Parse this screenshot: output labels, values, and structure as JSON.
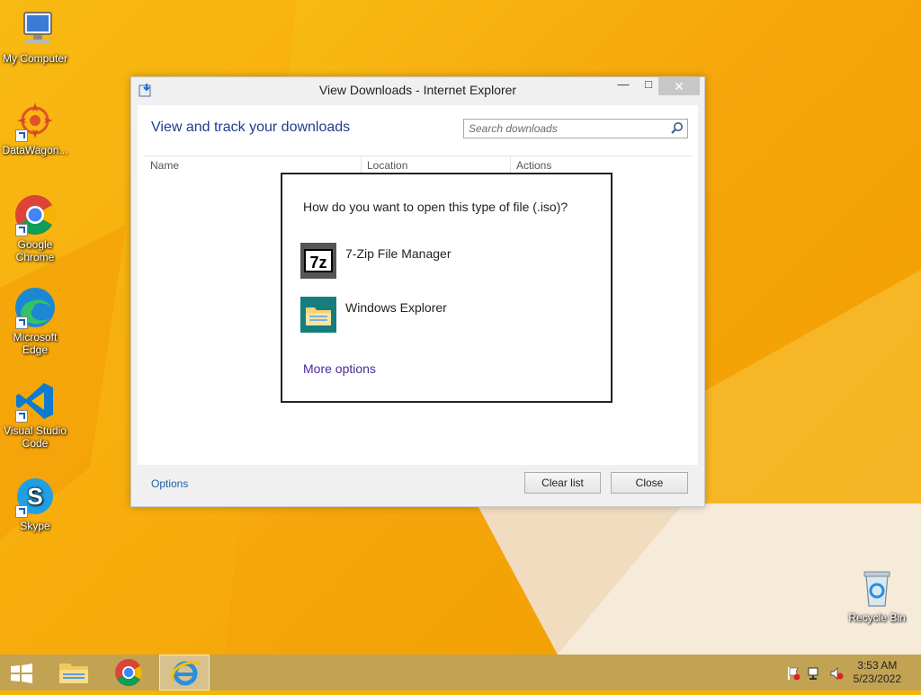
{
  "desktop": {
    "icons": [
      {
        "label": "My Computer"
      },
      {
        "label": "DataWagon..."
      },
      {
        "label": "Google Chrome"
      },
      {
        "label": "Microsoft Edge"
      },
      {
        "label": "Visual Studio Code"
      },
      {
        "label": "Skype"
      },
      {
        "label": "Recycle Bin"
      }
    ]
  },
  "window": {
    "title": "View Downloads - Internet Explorer",
    "min_glyph": "—",
    "max_glyph": "□",
    "close_glyph": "✕",
    "heading": "View and track your downloads",
    "search_placeholder": "Search downloads",
    "columns": [
      "Name",
      "Location",
      "Actions"
    ],
    "footer": {
      "options_label": "Options",
      "clear_label": "Clear list",
      "close_label": "Close"
    }
  },
  "open_with": {
    "question": "How do you want to open this type of file (.iso)?",
    "items": [
      {
        "label": "7-Zip File Manager",
        "icon": "7zip-icon"
      },
      {
        "label": "Windows Explorer",
        "icon": "folder-icon"
      }
    ],
    "more_options": "More options"
  },
  "taskbar": {
    "time": "3:53 AM",
    "date": "5/23/2022",
    "items": [
      "start-icon",
      "file-explorer-icon",
      "chrome-icon",
      "internet-explorer-icon"
    ]
  },
  "colors": {
    "desktop_bg": "#f5a40a",
    "taskbar": "#c2a253",
    "heading": "#1e3d8f",
    "link": "#1e5fa8"
  }
}
